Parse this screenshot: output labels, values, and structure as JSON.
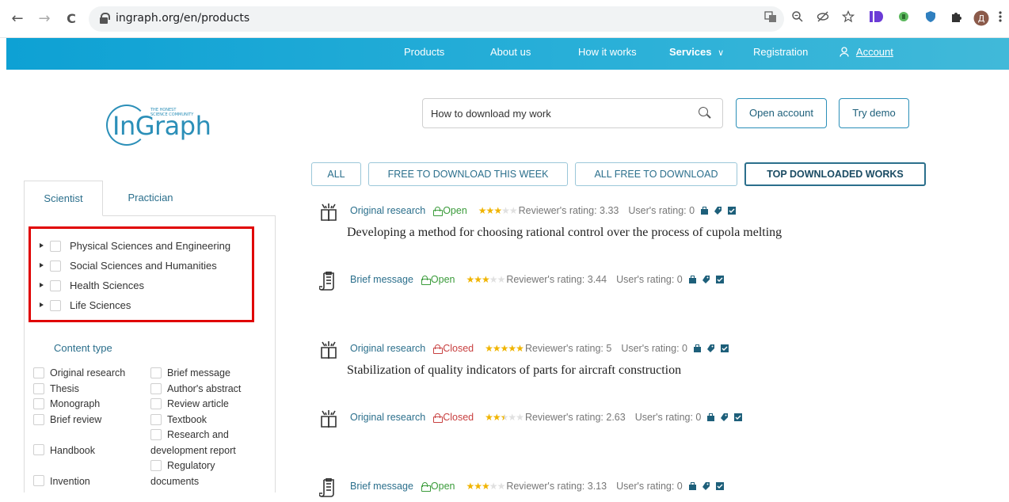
{
  "browser": {
    "url": "ingraph.org/en/products",
    "nav": {
      "back": "←",
      "forward": "→",
      "reload": "C"
    }
  },
  "site_nav": {
    "items": [
      "Products",
      "About us",
      "How it works",
      "Services",
      "Registration",
      "Account"
    ]
  },
  "logo": {
    "tagline_1": "THE HONEST",
    "tagline_2": "SCIENCE COMMUNITY",
    "name": "InGraph"
  },
  "search": {
    "value": "How to download my work"
  },
  "buttons": {
    "open_account": "Open account",
    "try_demo": "Try demo"
  },
  "filters": [
    "ALL",
    "FREE TO DOWNLOAD THIS WEEK",
    "ALL FREE TO DOWNLOAD",
    "TOP DOWNLOADED WORKS"
  ],
  "sidebar": {
    "tabs": [
      "Scientist",
      "Practician"
    ],
    "tree": [
      "Physical Sciences and Engineering",
      "Social Sciences and Humanities",
      "Health Sciences",
      "Life Sciences"
    ],
    "content_type_title": "Content type",
    "content_types": {
      "col1": [
        "Original research",
        "Thesis",
        "Monograph",
        "Brief review",
        "Handbook",
        "Invention"
      ],
      "col2": [
        "Brief message",
        "Author's abstract",
        "Review article",
        "Textbook",
        "Research and",
        "development report",
        "Regulatory",
        "documents"
      ]
    }
  },
  "results": [
    {
      "type": "Original research",
      "status": "Open",
      "stars": 3,
      "rating": "Reviewer's rating: 3.33",
      "user": "User's rating: 0",
      "title": "Developing a method for choosing rational control over the process of cupola melting",
      "icon": "book-icon"
    },
    {
      "type": "Brief message",
      "status": "Open",
      "stars": 3,
      "rating": "Reviewer's rating: 3.44",
      "user": "User's rating: 0",
      "title": "",
      "icon": "scroll-icon"
    },
    {
      "type": "Original research",
      "status": "Closed",
      "stars": 5,
      "rating": "Reviewer's rating: 5",
      "user": "User's rating: 0",
      "title": "Stabilization of quality indicators of parts for aircraft construction",
      "icon": "book-icon"
    },
    {
      "type": "Original research",
      "status": "Closed",
      "stars": 2.5,
      "rating": "Reviewer's rating: 2.63",
      "user": "User's rating: 0",
      "title": "",
      "icon": "book-icon"
    },
    {
      "type": "Brief message",
      "status": "Open",
      "stars": 3,
      "rating": "Reviewer's rating: 3.13",
      "user": "User's rating: 0",
      "title": "",
      "icon": "scroll-icon"
    }
  ],
  "colors": {
    "accent": "#2b8fb8",
    "nav_bg": "#1aa6d6",
    "highlight": "#e00000",
    "open": "#3a9b3a",
    "closed": "#c84040",
    "star": "#f0b400"
  }
}
